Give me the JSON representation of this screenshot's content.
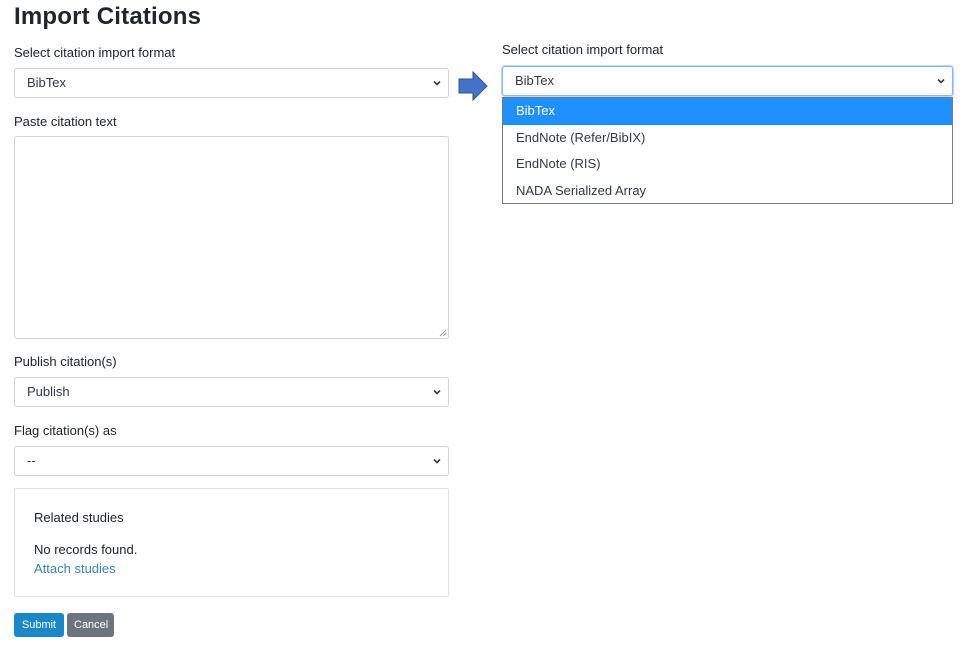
{
  "page": {
    "title": "Import Citations"
  },
  "form": {
    "format_label": "Select citation import format",
    "format_value": "BibTex",
    "paste_label": "Paste citation text",
    "paste_value": "",
    "publish_label": "Publish citation(s)",
    "publish_value": "Publish",
    "flag_label": "Flag citation(s) as",
    "flag_value": "--"
  },
  "related": {
    "title": "Related studies",
    "empty_text": "No records found.",
    "attach_link": "Attach studies"
  },
  "buttons": {
    "submit": "Submit",
    "cancel": "Cancel"
  },
  "callout": {
    "format_label": "Select citation import format",
    "format_value": "BibTex",
    "options": [
      {
        "label": "BibTex",
        "selected": true
      },
      {
        "label": "EndNote (Refer/BibIX)",
        "selected": false
      },
      {
        "label": "EndNote (RIS)",
        "selected": false
      },
      {
        "label": "NADA Serialized Array",
        "selected": false
      }
    ],
    "arrow_color": "#4472c4",
    "highlight_color": "#1e90ff"
  }
}
